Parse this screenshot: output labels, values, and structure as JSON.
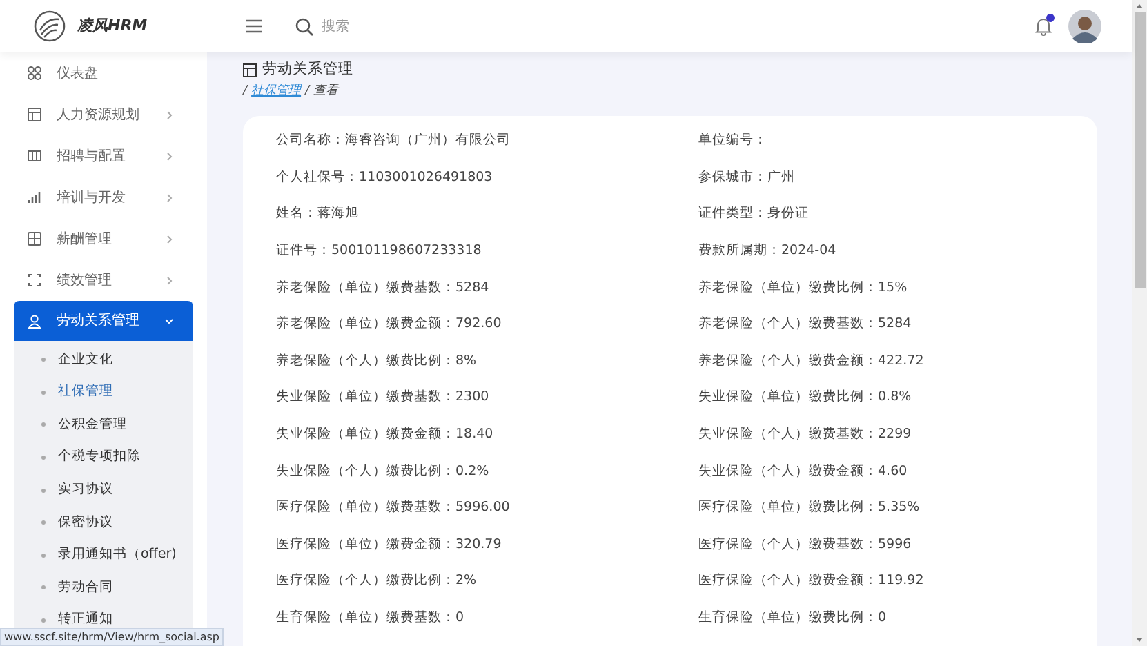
{
  "header": {
    "logo_text": "凌风HRM",
    "search": {
      "placeholder": "搜索"
    },
    "has_notification": true
  },
  "sidebar": {
    "items": [
      {
        "label": "仪表盘",
        "selected": false
      },
      {
        "label": "人力资源规划",
        "expanded": false,
        "selected": false
      },
      {
        "label": "招聘与配置",
        "expanded": false,
        "selected": false
      },
      {
        "label": "培训与开发",
        "expanded": false,
        "selected": false
      },
      {
        "label": "薪酬管理",
        "expanded": false,
        "selected": false
      },
      {
        "label": "绩效管理",
        "expanded": false,
        "selected": false
      },
      {
        "label": "劳动关系管理",
        "expanded": true,
        "selected": true,
        "children": [
          {
            "label": "企业文化",
            "selected": false
          },
          {
            "label": "社保管理",
            "selected": true
          },
          {
            "label": "公积金管理",
            "selected": false
          },
          {
            "label": "个税专项扣除",
            "selected": false
          },
          {
            "label": "实习协议",
            "selected": false
          },
          {
            "label": "保密协议",
            "selected": false
          },
          {
            "label": "录用通知书（offer)",
            "selected": false
          },
          {
            "label": "劳动合同",
            "selected": false
          },
          {
            "label": "转正通知",
            "selected": false
          }
        ]
      }
    ]
  },
  "page": {
    "title": "劳动关系管理",
    "breadcrumb_separator": "/",
    "breadcrumb": [
      {
        "label": "社保管理",
        "link": true
      },
      {
        "label": "查看",
        "link": false
      }
    ]
  },
  "details": [
    [
      "公司名称：海睿咨询（广州）有限公司",
      "单位编号："
    ],
    [
      "个人社保号：1103001026491803",
      "参保城市：广州"
    ],
    [
      "姓名：蒋海旭",
      "证件类型：身份证"
    ],
    [
      "证件号：500101198607233318",
      "费款所属期：2024-04"
    ],
    [
      "养老保险（单位）缴费基数：5284",
      "养老保险（单位）缴费比例：15%"
    ],
    [
      "养老保险（单位）缴费金额：792.60",
      "养老保险（个人）缴费基数：5284"
    ],
    [
      "养老保险（个人）缴费比例：8%",
      "养老保险（个人）缴费金额：422.72"
    ],
    [
      "失业保险（单位）缴费基数：2300",
      "失业保险（单位）缴费比例：0.8%"
    ],
    [
      "失业保险（单位）缴费金额：18.40",
      "失业保险（个人）缴费基数：2299"
    ],
    [
      "失业保险（个人）缴费比例：0.2%",
      "失业保险（个人）缴费金额：4.60"
    ],
    [
      "医疗保险（单位）缴费基数：5996.00",
      "医疗保险（单位）缴费比例：5.35%"
    ],
    [
      "医疗保险（单位）缴费金额：320.79",
      "医疗保险（个人）缴费基数：5996"
    ],
    [
      "医疗保险（个人）缴费比例：2%",
      "医疗保险（个人）缴费金额：119.92"
    ],
    [
      "生育保险（单位）缴费基数：0",
      "生育保险（单位）缴费比例：0"
    ]
  ],
  "status_bar": {
    "url": "www.sscf.site/hrm/View/hrm_social.asp"
  }
}
